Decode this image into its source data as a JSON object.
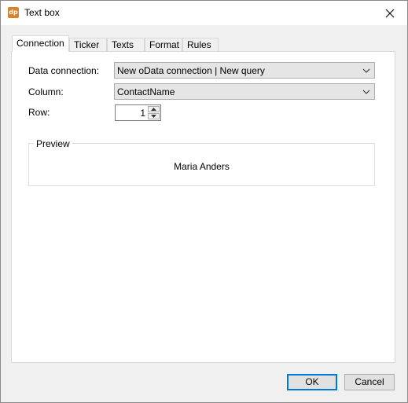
{
  "window": {
    "title": "Text box",
    "app_icon_text": "dp"
  },
  "tabs": [
    {
      "label": "Connection",
      "active": true
    },
    {
      "label": "Ticker"
    },
    {
      "label": "Texts"
    },
    {
      "label": "Format"
    },
    {
      "label": "Rules"
    }
  ],
  "form": {
    "data_connection_label": "Data connection:",
    "data_connection_value": "New oData connection | New query",
    "column_label": "Column:",
    "column_value": "ContactName",
    "row_label": "Row:",
    "row_value": "1"
  },
  "preview": {
    "legend": "Preview",
    "text": "Maria Anders"
  },
  "buttons": {
    "ok": "OK",
    "cancel": "Cancel"
  },
  "colors": {
    "app_icon": "#d9822b",
    "default_button_border": "#0078d7"
  }
}
